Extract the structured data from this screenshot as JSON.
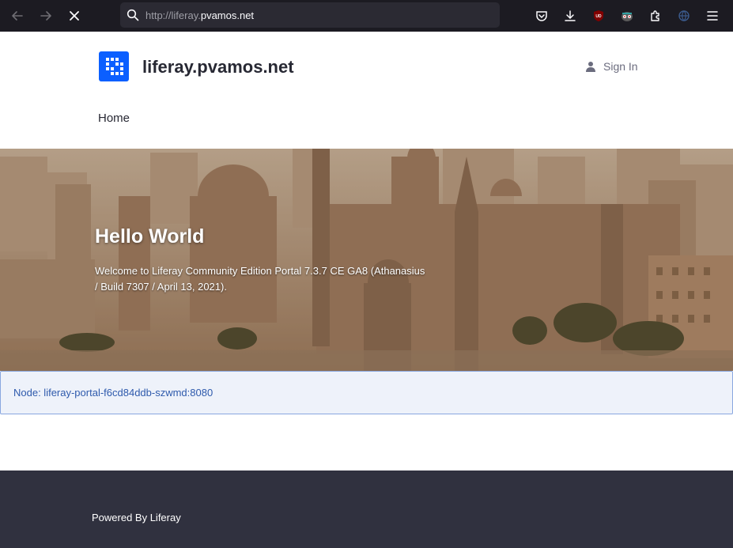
{
  "browser": {
    "url_prefix": "http://liferay.",
    "url_domain": "pvamos.net",
    "icons": [
      "back-icon",
      "forward-icon",
      "stop-icon",
      "search-icon",
      "pocket-icon",
      "download-icon",
      "ublock-icon",
      "privacy-badger-icon",
      "extensions-icon",
      "globe-icon",
      "menu-icon"
    ],
    "ublock_badge": "UD"
  },
  "header": {
    "site_name": "liferay.pvamos.net",
    "sign_in": "Sign In",
    "nav": [
      {
        "label": "Home"
      }
    ]
  },
  "hero": {
    "title": "Hello World",
    "text": "Welcome to Liferay Community Edition Portal 7.3.7 CE GA8 (Athanasius / Build 7307 / April 13, 2021)."
  },
  "node": {
    "text": "Node: liferay-portal-f6cd84ddb-szwmd:8080"
  },
  "footer": {
    "text": "Powered By Liferay"
  },
  "colors": {
    "browser_bg": "#1c1b22",
    "url_bg": "#2b2a33",
    "logo_blue": "#0b5fff",
    "node_bg": "#eef2fa",
    "node_border": "#89a7e0",
    "node_text": "#2e5aac",
    "footer_bg": "#30313f"
  }
}
